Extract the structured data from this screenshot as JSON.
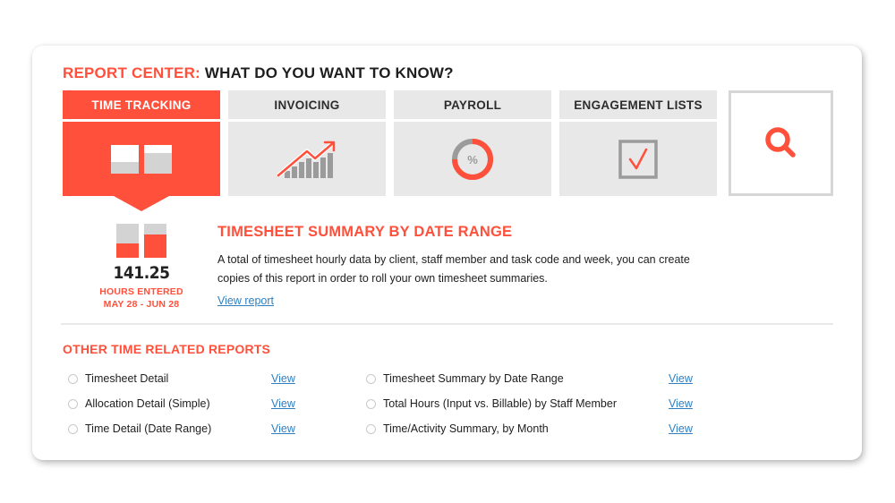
{
  "header": {
    "title_accent": "REPORT CENTER:",
    "title_rest": " WHAT DO YOU WANT TO KNOW?"
  },
  "categories": [
    {
      "label": "TIME TRACKING",
      "icon": "timesheet-bars-icon",
      "active": true
    },
    {
      "label": "INVOICING",
      "icon": "trend-chart-icon",
      "active": false
    },
    {
      "label": "PAYROLL",
      "icon": "percent-donut-icon",
      "active": false
    },
    {
      "label": "ENGAGEMENT LISTS",
      "icon": "checkbox-check-icon",
      "active": false
    }
  ],
  "search": {
    "icon": "search-icon"
  },
  "summary": {
    "value": "141.25",
    "label": "HOURS ENTERED",
    "range": "MAY 28 - JUN 28"
  },
  "featured_report": {
    "title": "TIMESHEET SUMMARY BY DATE RANGE",
    "description": "A total of timesheet hourly data by client, staff member and task code and week, you can create copies of this report in order to roll your own timesheet summaries.",
    "link": "View report"
  },
  "other_reports": {
    "title": "OTHER TIME RELATED REPORTS",
    "left": [
      {
        "name": "Timesheet Detail",
        "link": "View"
      },
      {
        "name": "Allocation Detail (Simple)",
        "link": "View"
      },
      {
        "name": "Time Detail (Date Range)",
        "link": "View"
      }
    ],
    "right": [
      {
        "name": "Timesheet Summary by Date Range",
        "link": "View"
      },
      {
        "name": "Total Hours (Input vs. Billable) by Staff Member",
        "link": "View"
      },
      {
        "name": "Time/Activity Summary, by Month",
        "link": "View"
      }
    ]
  },
  "colors": {
    "accent": "#ff503b",
    "tile_bg": "#e8e8e8",
    "link": "#2f7fc1",
    "icon_gray": "#9b9b9b"
  }
}
